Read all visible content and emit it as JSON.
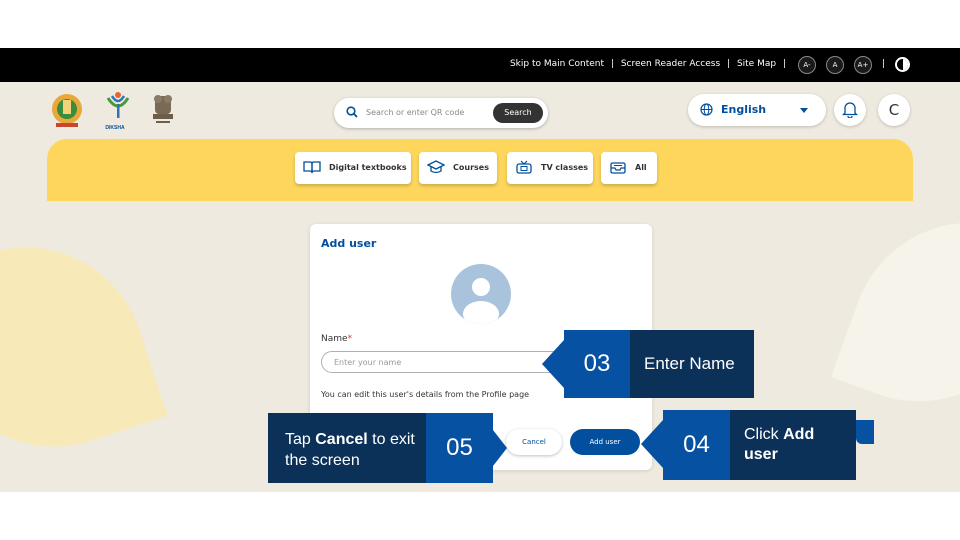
{
  "utility_bar": {
    "skip": "Skip to Main Content",
    "screen_reader": "Screen Reader Access",
    "site_map": "Site Map",
    "font_decrease": "A-",
    "font_normal": "A",
    "font_increase": "A+",
    "divider": "|"
  },
  "header": {
    "logo_caption": "DIKSHA",
    "search_placeholder": "Search or enter QR code",
    "search_button": "Search",
    "language": "English",
    "user_initial": "C"
  },
  "nav": {
    "items": [
      {
        "label": "Digital textbooks",
        "icon": "book-icon"
      },
      {
        "label": "Courses",
        "icon": "graduation-cap-icon"
      },
      {
        "label": "TV classes",
        "icon": "tv-icon"
      },
      {
        "label": "All",
        "icon": "inbox-icon"
      }
    ]
  },
  "dialog": {
    "title": "Add user",
    "name_label": "Name",
    "required_mark": "*",
    "name_placeholder": "Enter your name",
    "hint": "You can edit this user's details from the Profile page",
    "cancel_label": "Cancel",
    "add_label": "Add user"
  },
  "callouts": {
    "step3": {
      "number": "03",
      "text": "Enter Name"
    },
    "step4": {
      "number": "04",
      "text_prefix": "Click ",
      "text_bold": "Add user"
    },
    "step5": {
      "number": "05",
      "text_prefix": "Tap ",
      "text_bold": "Cancel",
      "text_suffix": " to exit the screen"
    }
  },
  "colors": {
    "brand_blue": "#024f9d",
    "nav_yellow": "#fdd65b",
    "callout_dark": "#0c3159",
    "callout_number": "#0751a2",
    "app_background": "#eeeae0"
  }
}
